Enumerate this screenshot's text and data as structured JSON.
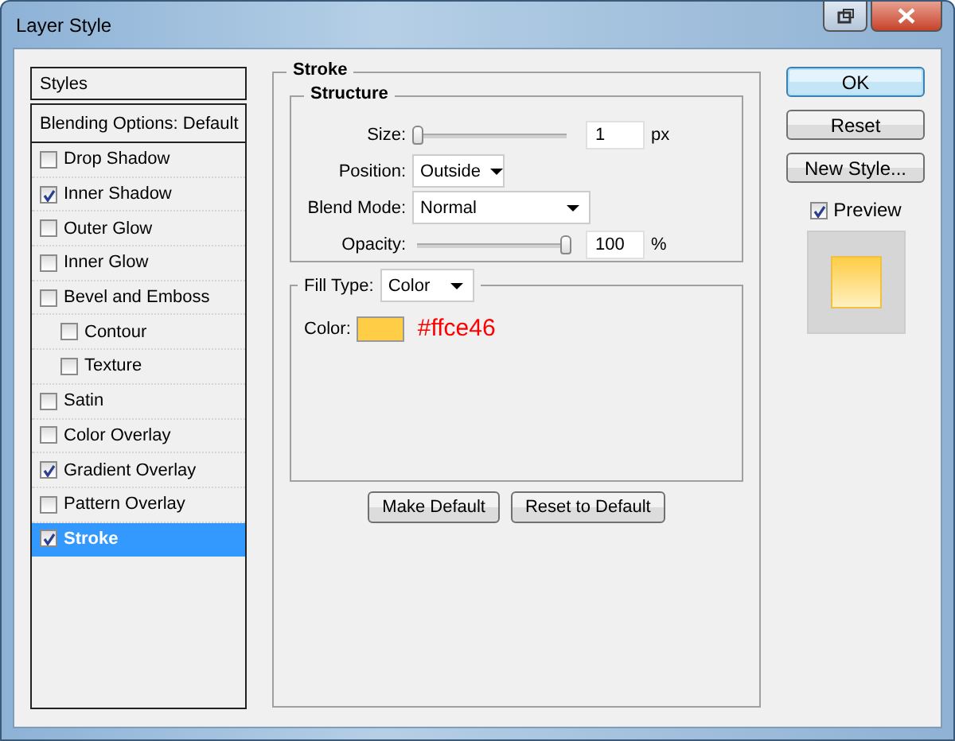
{
  "window": {
    "title": "Layer Style"
  },
  "styles_panel": {
    "header": "Styles",
    "blending": "Blending Options: Default",
    "items": [
      {
        "label": "Drop Shadow",
        "kind": "effect",
        "checked": false,
        "selected": false
      },
      {
        "label": "Inner Shadow",
        "kind": "effect",
        "checked": true,
        "selected": false
      },
      {
        "label": "Outer Glow",
        "kind": "effect",
        "checked": false,
        "selected": false
      },
      {
        "label": "Inner Glow",
        "kind": "effect",
        "checked": false,
        "selected": false
      },
      {
        "label": "Bevel and Emboss",
        "kind": "effect",
        "checked": false,
        "selected": false
      },
      {
        "label": "Contour",
        "kind": "sub",
        "checked": false,
        "selected": false
      },
      {
        "label": "Texture",
        "kind": "sub",
        "checked": false,
        "selected": false
      },
      {
        "label": "Satin",
        "kind": "effect",
        "checked": false,
        "selected": false
      },
      {
        "label": "Color Overlay",
        "kind": "effect",
        "checked": false,
        "selected": false
      },
      {
        "label": "Gradient Overlay",
        "kind": "effect",
        "checked": true,
        "selected": false
      },
      {
        "label": "Pattern Overlay",
        "kind": "effect",
        "checked": false,
        "selected": false
      },
      {
        "label": "Stroke",
        "kind": "effect",
        "checked": true,
        "selected": true
      }
    ]
  },
  "stroke": {
    "title": "Stroke",
    "structure": {
      "title": "Structure",
      "size": {
        "label": "Size:",
        "value": "1",
        "unit": "px",
        "level": 0
      },
      "position": {
        "label": "Position:",
        "value": "Outside"
      },
      "blend_mode": {
        "label": "Blend Mode:",
        "value": "Normal"
      },
      "opacity": {
        "label": "Opacity:",
        "value": "100",
        "unit": "%",
        "level": 1
      }
    },
    "fill": {
      "label": "Fill Type:",
      "value": "Color",
      "color_label": "Color:",
      "color": "#ffce46",
      "annotation": "#ffce46"
    },
    "buttons": [
      "Make Default",
      "Reset to Default"
    ]
  },
  "actions": {
    "buttons": [
      {
        "label": "OK",
        "default": true
      },
      {
        "label": "Reset",
        "default": false
      },
      {
        "label": "New Style...",
        "default": false
      }
    ],
    "preview": {
      "label": "Preview",
      "checked": true
    }
  }
}
